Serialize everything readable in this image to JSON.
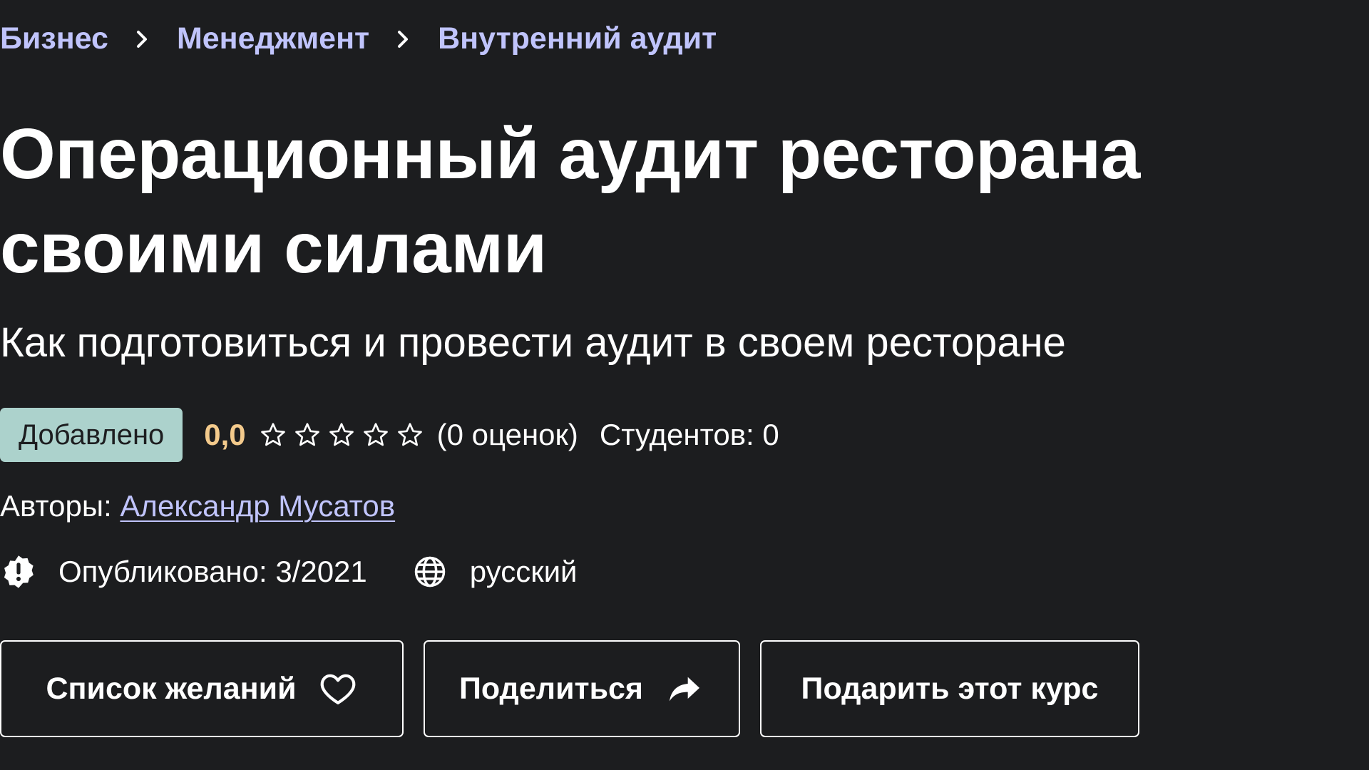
{
  "breadcrumb": {
    "items": [
      "Бизнес",
      "Менеджмент",
      "Внутренний аудит"
    ]
  },
  "course": {
    "title": "Операционный аудит ресторана своими силами",
    "subtitle": "Как подготовиться и провести аудит в своем ресторане",
    "badge": "Добавлено",
    "rating_value": "0,0",
    "rating_stars": 0,
    "rating_count": "(0 оценок)",
    "students": "Студентов: 0",
    "authors_label": "Авторы:",
    "author_name": "Александр Мусатов",
    "published": "Опубликовано: 3/2021",
    "language": "русский"
  },
  "buttons": {
    "wishlist": "Список желаний",
    "share": "Поделиться",
    "gift": "Подарить этот курс"
  },
  "icons": {
    "breadcrumb_separator": "chevron-right-icon",
    "star": "star-outline-icon",
    "published": "alert-badge-icon",
    "language": "globe-icon",
    "wishlist": "heart-outline-icon",
    "share": "share-arrow-icon"
  },
  "colors": {
    "background": "#1c1d1f",
    "link": "#c0c4fc",
    "badge_bg": "#acd2cc",
    "rating": "#f3ca8c"
  }
}
